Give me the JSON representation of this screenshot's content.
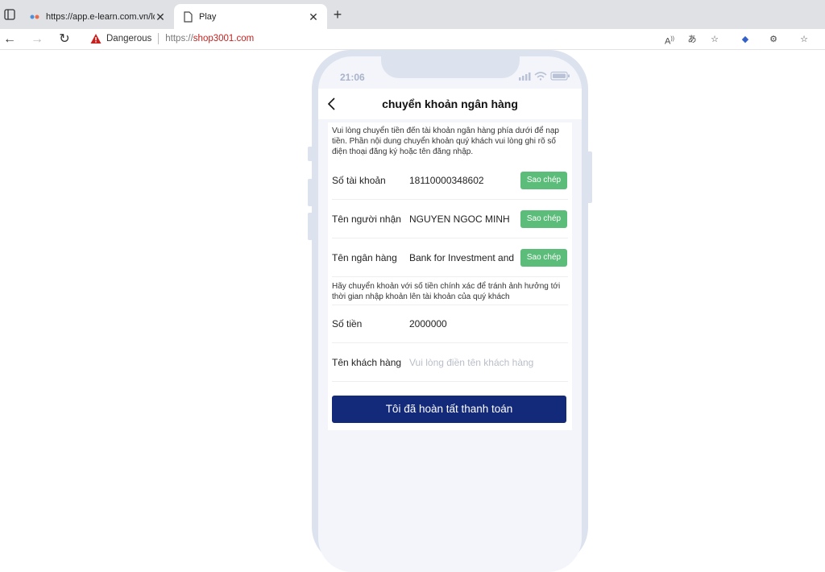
{
  "browser": {
    "tabs": [
      {
        "title": "https://app.e-learn.com.vn/log",
        "active": false
      },
      {
        "title": "Play",
        "active": true
      }
    ],
    "security_label": "Dangerous",
    "url_protocol": "https://",
    "url_host": "shop3001.com"
  },
  "phone": {
    "status_time": "21:06",
    "header_title": "chuyển khoản ngân hàng",
    "notice_top": "Vui lòng chuyển tiền đến tài khoản ngân hàng phía dưới để nạp tiền. Phần nội dung chuyển khoản quý khách vui lòng ghi rõ số điện thoại đăng ký hoặc tên đăng nhập.",
    "copy_label": "Sao chép",
    "rows": [
      {
        "label": "Số tài khoản",
        "value": "18110000348602"
      },
      {
        "label": "Tên người nhận",
        "value": "NGUYEN NGOC MINH"
      },
      {
        "label": "Tên ngân hàng",
        "value": "Bank for Investment and"
      }
    ],
    "notice_mid": "Hãy chuyển khoản với số tiền chính xác để tránh ảnh hưởng tới thời gian nhập khoản lên tài khoản của quý khách",
    "amount_label": "Số tiền",
    "amount_value": "2000000",
    "customer_label": "Tên khách hàng",
    "customer_placeholder": "Vui lòng điền tên khách hàng",
    "submit_label": "Tôi đã hoàn tất thanh toán"
  },
  "colors": {
    "copy_button": "#5cbd7a",
    "submit_button": "#13297a",
    "danger": "#c5221f"
  }
}
